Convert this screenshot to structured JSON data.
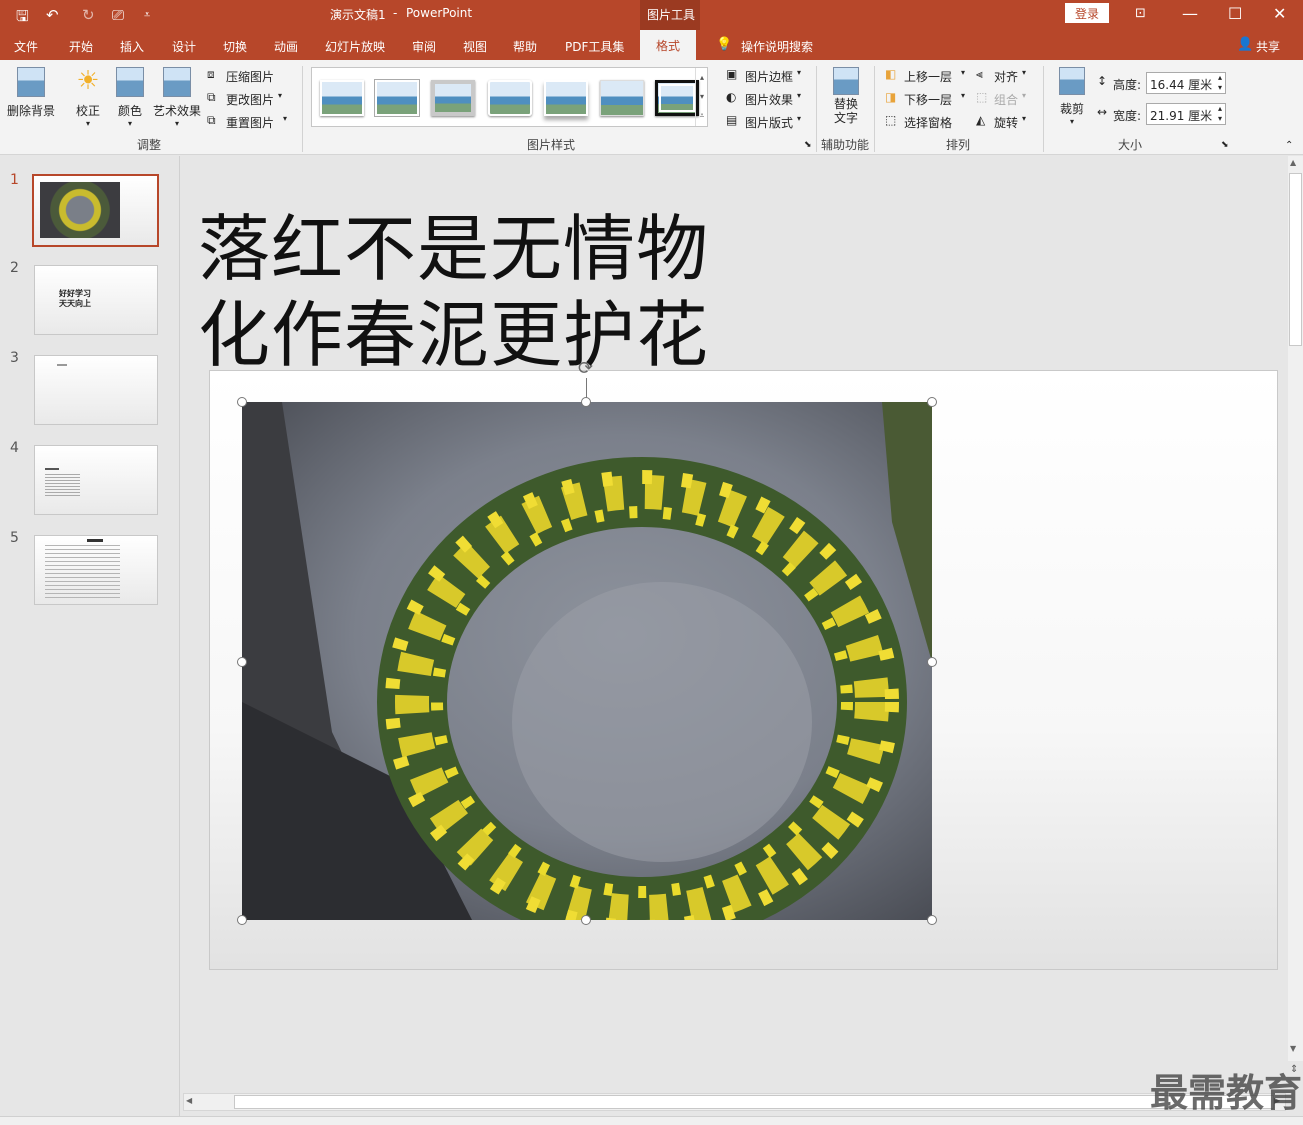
{
  "colors": {
    "accent": "#b7472a",
    "context_tab": "#9b3a21",
    "ribbon_bg": "#f3f3f3",
    "workspace": "#e6e6e6"
  },
  "titlebar": {
    "doc_title": "演示文稿1",
    "separator": "-",
    "app_name": "PowerPoint",
    "context_group": "图片工具",
    "login": "登录",
    "icons": [
      "save-icon",
      "undo-icon",
      "redo-icon",
      "present-icon",
      "customize-icon"
    ]
  },
  "tabs": [
    "文件",
    "开始",
    "插入",
    "设计",
    "切换",
    "动画",
    "幻灯片放映",
    "审阅",
    "视图",
    "帮助",
    "PDF工具集",
    "格式"
  ],
  "active_tab": "格式",
  "tell_me": "操作说明搜索",
  "share": "共享",
  "ribbon": {
    "adjust": {
      "remove_bg": "删除背景",
      "corrections": "校正",
      "color": "颜色",
      "artistic": "艺术效果",
      "compress": "压缩图片",
      "change": "更改图片",
      "reset": "重置图片",
      "label": "调整"
    },
    "styles": {
      "label": "图片样式",
      "border": "图片边框",
      "effects": "图片效果",
      "layout": "图片版式"
    },
    "accessibility": {
      "alt_text_line1": "替换",
      "alt_text_line2": "文字",
      "label": "辅助功能"
    },
    "arrange": {
      "bring_forward": "上移一层",
      "send_backward": "下移一层",
      "selection_pane": "选择窗格",
      "align": "对齐",
      "group": "组合",
      "rotate": "旋转",
      "label": "排列"
    },
    "size": {
      "crop": "裁剪",
      "height_label": "高度:",
      "height_value": "16.44 厘米",
      "width_label": "宽度:",
      "width_value": "21.91 厘米",
      "label": "大小"
    }
  },
  "thumbnails": [
    {
      "num": "1",
      "text": ""
    },
    {
      "num": "2",
      "text": "好好学习\n天天向上"
    },
    {
      "num": "3",
      "text": ""
    },
    {
      "num": "4",
      "text": ""
    },
    {
      "num": "5",
      "text": ""
    }
  ],
  "slide": {
    "title_line1": "落红不是无情物",
    "title_line2": "化作春泥更护花"
  },
  "watermark": "最需教育"
}
